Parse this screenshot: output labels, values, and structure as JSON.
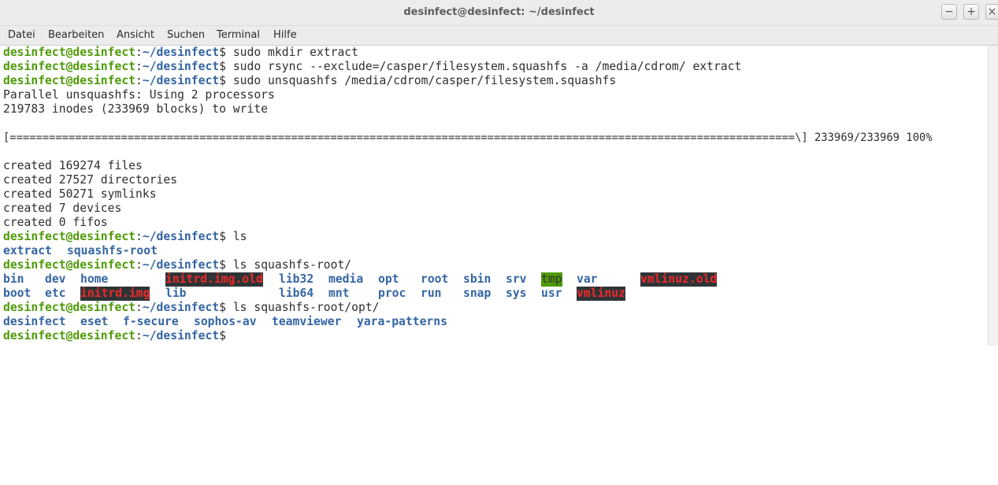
{
  "window": {
    "title": "desinfect@desinfect: ~/desinfect",
    "buttons": {
      "minimize": "−",
      "maximize": "+",
      "close": "×"
    }
  },
  "menu": [
    "Datei",
    "Bearbeiten",
    "Ansicht",
    "Suchen",
    "Terminal",
    "Hilfe"
  ],
  "prompt": {
    "user": "desinfect@desinfect",
    "sep": ":",
    "path": "~/desinfect",
    "end": "$"
  },
  "lines": {
    "cmd1": " sudo mkdir extract",
    "cmd2": " sudo rsync --exclude=/casper/filesystem.squashfs -a /media/cdrom/ extract",
    "cmd3": " sudo unsquashfs /media/cdrom/casper/filesystem.squashfs",
    "out1": "Parallel unsquashfs: Using 2 processors",
    "out2": "219783 inodes (233969 blocks) to write",
    "progress": "[========================================================================================================================\\] 233969/233969 100%",
    "created1": "created 169274 files",
    "created2": "created 27527 directories",
    "created3": "created 50271 symlinks",
    "created4": "created 7 devices",
    "created5": "created 0 fifos",
    "cmd4": " ls",
    "cmd5": " ls squashfs-root/",
    "cmd6": " ls squashfs-root/opt/"
  },
  "ls_root": [
    "extract",
    "squashfs-root"
  ],
  "ls_squashfs_row1": [
    "bin",
    "dev",
    "home",
    "initrd.img.old",
    "lib32",
    "media",
    "opt",
    "root",
    "sbin",
    "srv",
    "tmp",
    "var",
    "vmlinuz.old"
  ],
  "ls_squashfs_row2": [
    "boot",
    "etc",
    "initrd.img",
    "lib",
    "lib64",
    "mnt",
    "proc",
    "run",
    "snap",
    "sys",
    "usr",
    "vmlinuz"
  ],
  "ls_opt": [
    "desinfect",
    "eset",
    "f-secure",
    "sophos-av",
    "teamviewer",
    "yara-patterns"
  ],
  "colors": {
    "user": "#4e9a06",
    "dir": "#3465a4",
    "link_bg": "#2e3436",
    "link_fg": "#ef2929",
    "tmp_bg": "#4e9a06"
  }
}
